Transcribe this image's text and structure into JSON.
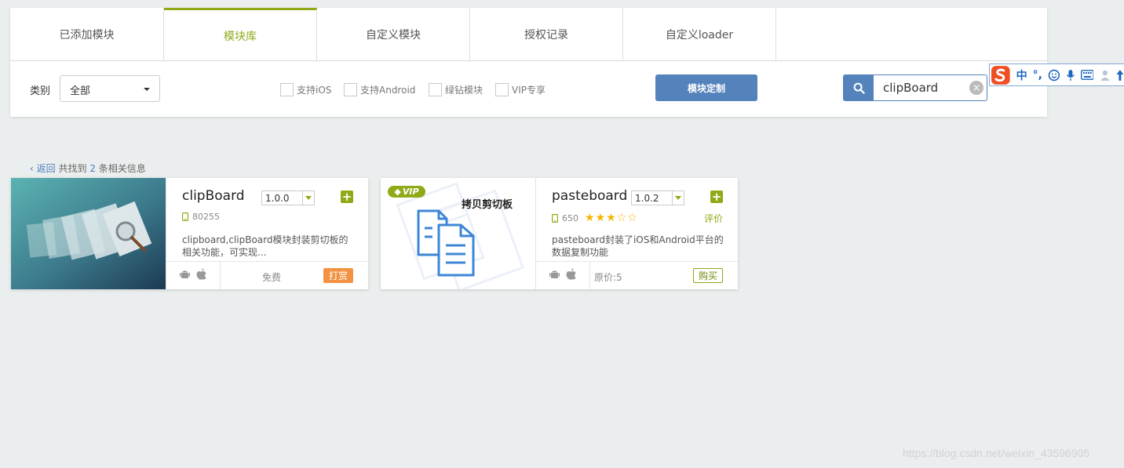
{
  "tabs": [
    {
      "label": "已添加模块",
      "active": false
    },
    {
      "label": "模块库",
      "active": true
    },
    {
      "label": "自定义模块",
      "active": false
    },
    {
      "label": "授权记录",
      "active": false
    },
    {
      "label": "自定义loader",
      "active": false
    }
  ],
  "filter": {
    "category_label": "类别",
    "category_value": "全部",
    "checkboxes": [
      "支持iOS",
      "支持Android",
      "绿钻模块",
      "VIP专享"
    ],
    "custom_button": "模块定制",
    "search_value": "clipBoard"
  },
  "ime": {
    "lang": "中"
  },
  "result": {
    "back": "返回",
    "prefix": "共找到",
    "count": "2",
    "suffix": "条相关信息"
  },
  "cards": [
    {
      "name": "clipBoard",
      "version": "1.0.0",
      "installs": "80255",
      "description": "clipboard,clipBoard模块封装剪切板的相关功能，可实现...",
      "price": "免费",
      "action": "打赏"
    },
    {
      "name": "pasteboard",
      "version": "1.0.2",
      "installs": "650",
      "rating": 3,
      "rate_label": "评价",
      "description": "pasteboard封装了iOS和Android平台的数据复制功能",
      "thumb_title": "拷贝剪切板",
      "vip_badge": "VIP",
      "price": "原价:5",
      "action": "购买"
    }
  ],
  "watermark": "https://blog.csdn.net/weixin_43596905",
  "colors": {
    "accent_green": "#8eaa17",
    "accent_blue": "#5482bb",
    "reward_orange": "#f39243"
  }
}
